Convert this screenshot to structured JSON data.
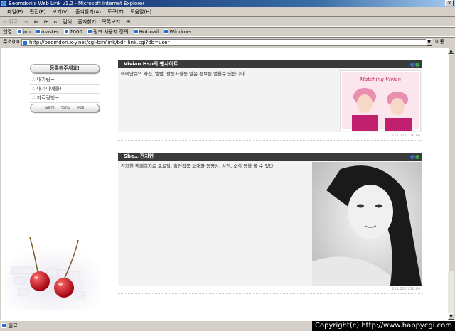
{
  "window": {
    "title": "Beomdori's Web Link v1.2 - Microsoft Internet Explorer",
    "close": "×"
  },
  "menu": [
    "파일(F)",
    "편집(E)",
    "보기(V)",
    "즐겨찾기(A)",
    "도구(T)",
    "도움말(H)"
  ],
  "toolbar": {
    "back": "← 뒤로",
    "forward": "→",
    "stop": "⊗",
    "refresh": "⟳",
    "home": "⌂",
    "search": "검색",
    "favorites": "즐겨찾기",
    "history": "목록보기",
    "mail": "✉"
  },
  "links": {
    "label": "연결",
    "items": [
      "job",
      "master",
      "2000",
      "링크 사용자 정의",
      "Hotmail",
      "Windows"
    ]
  },
  "address": {
    "label": "주소(D)",
    "url": "http://beomdori.x-y.net/cgi-bin/link/bdr_link.cgi?db=user",
    "go": "이동"
  },
  "sidebar": {
    "register": "등록해주세요!",
    "nav": [
      "∴ 내가링~",
      "∴ 내가디예를!",
      "∴ 자료링방~"
    ],
    "counters": [
      "WRITE",
      "TOTAL",
      "PAGE"
    ]
  },
  "posts": [
    {
      "title": "Vivian Hsu의 팬사이트",
      "desc": "비비안슈의 사진, 앨범, 활동사항등 많은 정보를 얻을수 있습니다.",
      "ip": "211.222.216.84",
      "photo_caption": "Matching Vivian"
    },
    {
      "title": "She...전지현",
      "desc": "전지현 팬페이지로 프로필, 출연작품 소개와 동영상, 사진, 소식 등을 볼 수 있다.",
      "ip": "211.222.216.84"
    }
  ],
  "status": {
    "text": "완료",
    "copyright": "Copyright(c) http://www.happycgi.com"
  },
  "colors": {
    "titlebar": "#0a246a",
    "post_header": "#3a3a3a",
    "chrome": "#d4d0c8"
  }
}
